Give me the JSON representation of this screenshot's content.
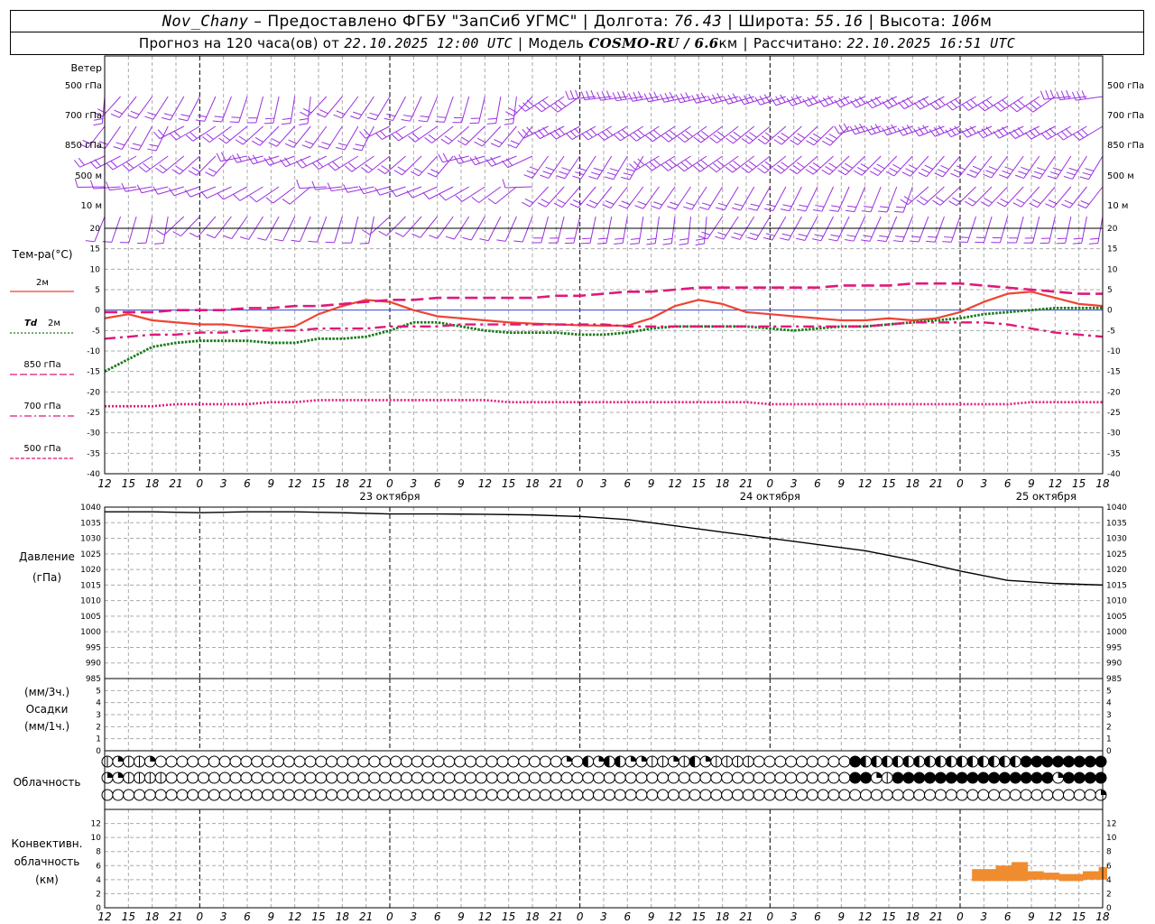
{
  "header": {
    "station": "Nov_Chany",
    "provider": "Предоставлено ФГБУ \"ЗапСиб УГМС\"",
    "lon_label": "Долгота:",
    "lon": "76.43",
    "lat_label": "Широта:",
    "lat": "55.16",
    "alt_label": "Высота:",
    "alt": "106",
    "alt_unit": "м",
    "forecast_label": "Прогноз на 120 часа(ов) от",
    "forecast_start": "22.10.2025 12:00 UTC",
    "model_label": "Модель",
    "model": "COSMO-RU / 6.6",
    "model_unit": "км",
    "calc_label": "Рассчитано:",
    "calc_time": "22.10.2025 16:51 UTC"
  },
  "labels": {
    "wind": "Ветер",
    "wind_levels": [
      "500 гПа",
      "700 гПа",
      "850 гПа",
      "500  м",
      "10   м"
    ],
    "temp": "Тем-ра(°C)",
    "t2m": "2м",
    "td": "Td",
    "td2m": "2м",
    "t850": "850 гПа",
    "t700": "700 гПа",
    "t500": "500 гПа",
    "pressure": "Давление",
    "pressure_unit": "(гПа)",
    "precip_unit3": "(мм/3ч.)",
    "precip": "Осадки",
    "precip_unit1": "(мм/1ч.)",
    "cloud": "Облачность",
    "conv1": "Конвективн.",
    "conv2": "облачность",
    "conv3": "(км)"
  },
  "colors": {
    "wind": "#9b30e0",
    "t2m": "#ee4433",
    "td": "#1a7a1a",
    "t850": "#e0187a",
    "t700": "#e0187a",
    "t500": "#e0187a",
    "pressure": "#000000",
    "conv": "#f08c30",
    "zero_line": "#3344cc"
  },
  "chart_data": [
    {
      "type": "line",
      "title": "Тем-ра(°C)",
      "x_hours": [
        0,
        3,
        6,
        9,
        12,
        15,
        18,
        21,
        24,
        27,
        30,
        33,
        36,
        39,
        42,
        45,
        48,
        51,
        54,
        57,
        60,
        63,
        66,
        69,
        72,
        75,
        78,
        81,
        84,
        87,
        90,
        93,
        96,
        99,
        102,
        105,
        108,
        111,
        114,
        117,
        120,
        123,
        126
      ],
      "x_tick_labels": [
        "12",
        "15",
        "18",
        "21",
        "0",
        "3",
        "6",
        "9",
        "12",
        "15",
        "18",
        "21",
        "0",
        "3",
        "6",
        "9",
        "12",
        "15",
        "18",
        "21",
        "0",
        "3",
        "6",
        "9",
        "12",
        "15",
        "18",
        "21",
        "0",
        "3",
        "6",
        "9",
        "12",
        "15",
        "18",
        "21",
        "0",
        "3",
        "6",
        "9",
        "12",
        "15",
        "18"
      ],
      "day_labels": [
        "23 октября",
        "24 октября",
        "25 октября"
      ],
      "ylim": [
        -40,
        20
      ],
      "yticks": [
        20,
        15,
        10,
        5,
        0,
        -5,
        -10,
        -15,
        -20,
        -25,
        -30,
        -35,
        -40
      ],
      "series": [
        {
          "name": "2м",
          "style": "solid",
          "values": [
            -2,
            -1,
            -2.5,
            -3,
            -3.5,
            -3.5,
            -4,
            -4.5,
            -4,
            -1,
            1,
            2.5,
            2,
            0,
            -1.5,
            -2,
            -2.5,
            -3,
            -3.3,
            -3.5,
            -3.7,
            -3.8,
            -3.8,
            -2,
            1,
            2.5,
            1.5,
            -0.5,
            -1,
            -1.5,
            -2,
            -2.5,
            -2.5,
            -2,
            -2.5,
            -2,
            -0.5,
            2,
            4,
            4.5,
            3,
            1.5,
            1
          ]
        },
        {
          "name": "Td 2м",
          "style": "dotted",
          "values": [
            -15,
            -12,
            -9,
            -8,
            -7.5,
            -7.5,
            -7.5,
            -8,
            -8,
            -7,
            -7,
            -6.5,
            -5,
            -3,
            -3,
            -4,
            -5,
            -5.5,
            -5.5,
            -5.5,
            -6,
            -6,
            -5.5,
            -4.5,
            -4,
            -4,
            -4,
            -4,
            -4.5,
            -5,
            -4.5,
            -4,
            -4,
            -3.5,
            -3,
            -2.5,
            -2,
            -1,
            -0.5,
            0,
            0.5,
            0.5,
            0.5
          ]
        },
        {
          "name": "850 гПа",
          "style": "long-dash",
          "values": [
            -0.5,
            -0.5,
            -0.5,
            0,
            0,
            0,
            0.5,
            0.5,
            1,
            1,
            1.5,
            2,
            2.5,
            2.5,
            3,
            3,
            3,
            3,
            3,
            3.5,
            3.5,
            4,
            4.5,
            4.5,
            5,
            5.5,
            5.5,
            5.5,
            5.5,
            5.5,
            5.5,
            6,
            6,
            6,
            6.5,
            6.5,
            6.5,
            6,
            5.5,
            5,
            4.5,
            4,
            4
          ]
        },
        {
          "name": "700 гПа",
          "style": "dash-dot",
          "values": [
            -7,
            -6.5,
            -6,
            -6,
            -5.5,
            -5.5,
            -5,
            -5,
            -5,
            -4.5,
            -4.5,
            -4.5,
            -4,
            -4,
            -4,
            -3.5,
            -3.5,
            -3.5,
            -3.5,
            -3.5,
            -3.5,
            -3.5,
            -4,
            -4,
            -4,
            -4,
            -4,
            -4,
            -4,
            -4,
            -4,
            -4,
            -4,
            -3.5,
            -3,
            -3,
            -3,
            -3,
            -3.5,
            -4.5,
            -5.5,
            -6,
            -6.5
          ]
        },
        {
          "name": "500 гПа",
          "style": "dense-dot",
          "values": [
            -23.5,
            -23.5,
            -23.5,
            -23,
            -23,
            -23,
            -23,
            -22.5,
            -22.5,
            -22,
            -22,
            -22,
            -22,
            -22,
            -22,
            -22,
            -22,
            -22.5,
            -22.5,
            -22.5,
            -22.5,
            -22.5,
            -22.5,
            -22.5,
            -22.5,
            -22.5,
            -22.5,
            -22.5,
            -23,
            -23,
            -23,
            -23,
            -23,
            -23,
            -23,
            -23,
            -23,
            -23,
            -23,
            -22.5,
            -22.5,
            -22.5,
            -22.5
          ]
        }
      ]
    },
    {
      "type": "line",
      "title": "Давление",
      "ylabel": "(гПа)",
      "ylim": [
        985,
        1040
      ],
      "yticks": [
        1040,
        1035,
        1030,
        1025,
        1020,
        1015,
        1010,
        1005,
        1000,
        995,
        990,
        985
      ],
      "x_hours": [
        0,
        6,
        12,
        18,
        24,
        30,
        36,
        42,
        48,
        54,
        60,
        66,
        72,
        78,
        84,
        90,
        96,
        102,
        108,
        114,
        120,
        126
      ],
      "series": [
        {
          "name": "Давление",
          "values": [
            1038.5,
            1038.5,
            1038.2,
            1038.5,
            1038.5,
            1038.2,
            1037.8,
            1037.8,
            1037.7,
            1037.5,
            1037,
            1036,
            1034,
            1032,
            1030,
            1028,
            1026,
            1023,
            1019.5,
            1016.5,
            1015.5,
            1015
          ]
        }
      ]
    },
    {
      "type": "bar",
      "title": "Осадки",
      "ylim": [
        0,
        5
      ],
      "yticks": [
        5,
        4,
        3,
        2,
        1,
        0
      ],
      "series": [
        {
          "values": []
        }
      ]
    },
    {
      "type": "bar",
      "title": "Конвективн. облачность",
      "ylabel": "(км)",
      "ylim": [
        0,
        13
      ],
      "yticks": [
        12,
        10,
        8,
        6,
        4,
        2,
        0
      ],
      "x_hours": [
        110,
        111,
        112,
        113,
        114,
        115,
        116,
        117,
        118,
        119,
        120,
        121,
        122,
        123,
        124,
        125,
        126
      ],
      "base": [
        3.8,
        3.8,
        3.8,
        3.8,
        3.8,
        3.8,
        3.8,
        4,
        4,
        4,
        4,
        3.8,
        3.8,
        3.8,
        4,
        4,
        4
      ],
      "top": [
        5.5,
        5.5,
        5.5,
        6,
        6,
        6.5,
        6.5,
        5.2,
        5.2,
        5,
        5,
        4.8,
        4.8,
        4.8,
        5.2,
        5.2,
        5.8
      ]
    }
  ],
  "clouds": {
    "high": [
      1,
      2,
      1,
      1,
      2,
      0,
      0,
      0,
      0,
      0,
      0,
      0,
      0,
      0,
      0,
      0,
      0,
      0,
      0,
      0,
      0,
      0,
      0,
      0,
      0,
      0,
      0,
      0,
      0,
      0,
      0,
      0,
      0,
      0,
      0,
      0,
      0,
      0,
      0,
      0,
      0,
      0,
      0,
      2,
      0,
      3,
      2,
      3,
      3,
      2,
      2,
      1,
      1,
      2,
      1,
      3,
      2,
      1,
      1,
      1,
      1,
      0,
      0,
      0,
      0,
      0,
      0,
      0,
      0,
      0,
      4,
      3,
      3,
      3,
      3,
      3,
      3,
      3,
      3,
      3,
      3,
      3,
      3,
      3,
      3,
      3,
      4,
      4,
      4,
      4,
      4,
      4,
      4,
      4
    ],
    "mid": [
      2,
      2,
      1,
      1,
      1,
      1,
      0,
      0,
      0,
      0,
      0,
      0,
      0,
      0,
      0,
      0,
      0,
      0,
      0,
      0,
      0,
      0,
      0,
      0,
      0,
      0,
      0,
      0,
      0,
      0,
      0,
      0,
      0,
      0,
      0,
      0,
      0,
      0,
      0,
      0,
      0,
      0,
      0,
      0,
      0,
      0,
      0,
      0,
      0,
      0,
      0,
      0,
      0,
      0,
      0,
      0,
      0,
      0,
      0,
      0,
      0,
      0,
      0,
      0,
      0,
      0,
      0,
      0,
      0,
      0,
      4,
      4,
      2,
      1,
      4,
      4,
      4,
      4,
      4,
      4,
      4,
      4,
      4,
      4,
      4,
      4,
      4,
      4,
      4,
      2,
      4,
      4,
      4,
      4
    ],
    "low": [
      0,
      0,
      0,
      0,
      0,
      0,
      0,
      0,
      0,
      0,
      0,
      0,
      0,
      0,
      0,
      0,
      0,
      0,
      0,
      0,
      0,
      0,
      0,
      0,
      0,
      0,
      0,
      0,
      0,
      0,
      0,
      0,
      0,
      0,
      0,
      0,
      0,
      0,
      0,
      0,
      0,
      0,
      0,
      0,
      0,
      0,
      0,
      0,
      0,
      0,
      0,
      0,
      0,
      0,
      0,
      0,
      0,
      0,
      0,
      0,
      0,
      0,
      0,
      0,
      0,
      0,
      0,
      0,
      0,
      0,
      0,
      0,
      0,
      0,
      0,
      0,
      0,
      0,
      0,
      0,
      0,
      0,
      0,
      0,
      0,
      0,
      0,
      0,
      0,
      0,
      0,
      0,
      0,
      2
    ]
  }
}
